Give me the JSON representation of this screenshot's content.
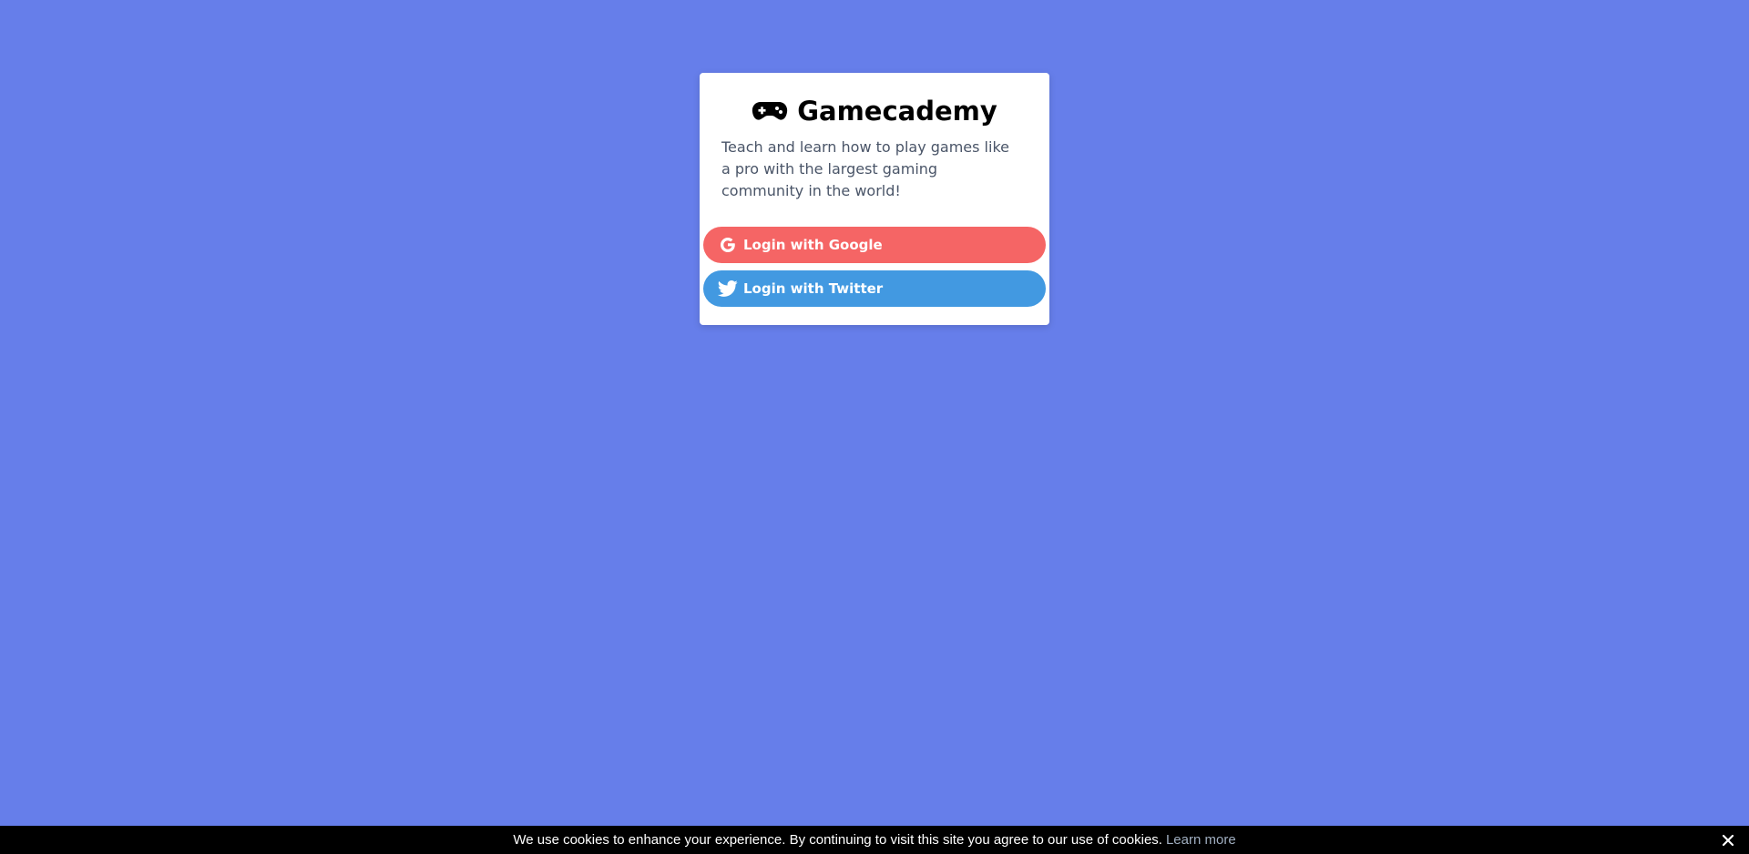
{
  "page": {
    "background_color": "#667eea"
  },
  "card": {
    "logo_icon": "gamepad-icon",
    "title": "Gamecademy",
    "tagline": "Teach and learn how to play games like a pro with the largest gaming community in the world!"
  },
  "login": {
    "google": {
      "label": "Login with Google",
      "icon": "google-icon",
      "color": "#f56565"
    },
    "twitter": {
      "label": "Login with Twitter",
      "icon": "twitter-icon",
      "color": "#4299e1"
    }
  },
  "cookie_banner": {
    "message": "We use cookies to enhance your experience. By continuing to visit this site you agree to our use of cookies.",
    "learn_more": "Learn more",
    "close_icon": "close-icon"
  }
}
